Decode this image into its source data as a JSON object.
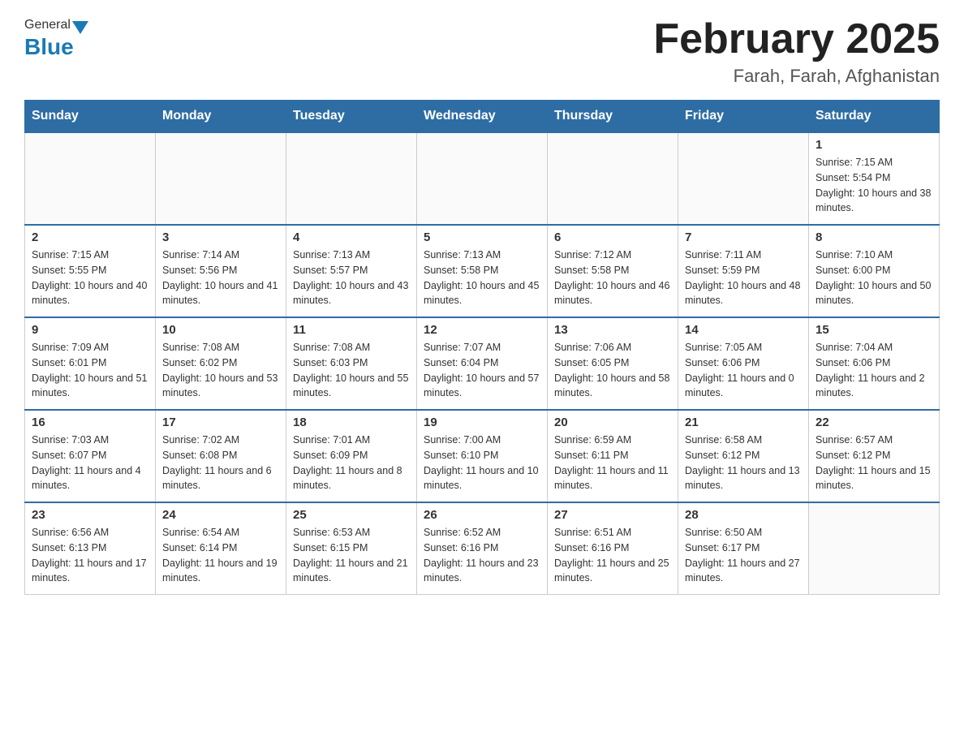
{
  "header": {
    "logo_general": "General",
    "logo_blue": "Blue",
    "title": "February 2025",
    "subtitle": "Farah, Farah, Afghanistan"
  },
  "days_of_week": [
    "Sunday",
    "Monday",
    "Tuesday",
    "Wednesday",
    "Thursday",
    "Friday",
    "Saturday"
  ],
  "weeks": [
    [
      {
        "day": "",
        "sunrise": "",
        "sunset": "",
        "daylight": ""
      },
      {
        "day": "",
        "sunrise": "",
        "sunset": "",
        "daylight": ""
      },
      {
        "day": "",
        "sunrise": "",
        "sunset": "",
        "daylight": ""
      },
      {
        "day": "",
        "sunrise": "",
        "sunset": "",
        "daylight": ""
      },
      {
        "day": "",
        "sunrise": "",
        "sunset": "",
        "daylight": ""
      },
      {
        "day": "",
        "sunrise": "",
        "sunset": "",
        "daylight": ""
      },
      {
        "day": "1",
        "sunrise": "Sunrise: 7:15 AM",
        "sunset": "Sunset: 5:54 PM",
        "daylight": "Daylight: 10 hours and 38 minutes."
      }
    ],
    [
      {
        "day": "2",
        "sunrise": "Sunrise: 7:15 AM",
        "sunset": "Sunset: 5:55 PM",
        "daylight": "Daylight: 10 hours and 40 minutes."
      },
      {
        "day": "3",
        "sunrise": "Sunrise: 7:14 AM",
        "sunset": "Sunset: 5:56 PM",
        "daylight": "Daylight: 10 hours and 41 minutes."
      },
      {
        "day": "4",
        "sunrise": "Sunrise: 7:13 AM",
        "sunset": "Sunset: 5:57 PM",
        "daylight": "Daylight: 10 hours and 43 minutes."
      },
      {
        "day": "5",
        "sunrise": "Sunrise: 7:13 AM",
        "sunset": "Sunset: 5:58 PM",
        "daylight": "Daylight: 10 hours and 45 minutes."
      },
      {
        "day": "6",
        "sunrise": "Sunrise: 7:12 AM",
        "sunset": "Sunset: 5:58 PM",
        "daylight": "Daylight: 10 hours and 46 minutes."
      },
      {
        "day": "7",
        "sunrise": "Sunrise: 7:11 AM",
        "sunset": "Sunset: 5:59 PM",
        "daylight": "Daylight: 10 hours and 48 minutes."
      },
      {
        "day": "8",
        "sunrise": "Sunrise: 7:10 AM",
        "sunset": "Sunset: 6:00 PM",
        "daylight": "Daylight: 10 hours and 50 minutes."
      }
    ],
    [
      {
        "day": "9",
        "sunrise": "Sunrise: 7:09 AM",
        "sunset": "Sunset: 6:01 PM",
        "daylight": "Daylight: 10 hours and 51 minutes."
      },
      {
        "day": "10",
        "sunrise": "Sunrise: 7:08 AM",
        "sunset": "Sunset: 6:02 PM",
        "daylight": "Daylight: 10 hours and 53 minutes."
      },
      {
        "day": "11",
        "sunrise": "Sunrise: 7:08 AM",
        "sunset": "Sunset: 6:03 PM",
        "daylight": "Daylight: 10 hours and 55 minutes."
      },
      {
        "day": "12",
        "sunrise": "Sunrise: 7:07 AM",
        "sunset": "Sunset: 6:04 PM",
        "daylight": "Daylight: 10 hours and 57 minutes."
      },
      {
        "day": "13",
        "sunrise": "Sunrise: 7:06 AM",
        "sunset": "Sunset: 6:05 PM",
        "daylight": "Daylight: 10 hours and 58 minutes."
      },
      {
        "day": "14",
        "sunrise": "Sunrise: 7:05 AM",
        "sunset": "Sunset: 6:06 PM",
        "daylight": "Daylight: 11 hours and 0 minutes."
      },
      {
        "day": "15",
        "sunrise": "Sunrise: 7:04 AM",
        "sunset": "Sunset: 6:06 PM",
        "daylight": "Daylight: 11 hours and 2 minutes."
      }
    ],
    [
      {
        "day": "16",
        "sunrise": "Sunrise: 7:03 AM",
        "sunset": "Sunset: 6:07 PM",
        "daylight": "Daylight: 11 hours and 4 minutes."
      },
      {
        "day": "17",
        "sunrise": "Sunrise: 7:02 AM",
        "sunset": "Sunset: 6:08 PM",
        "daylight": "Daylight: 11 hours and 6 minutes."
      },
      {
        "day": "18",
        "sunrise": "Sunrise: 7:01 AM",
        "sunset": "Sunset: 6:09 PM",
        "daylight": "Daylight: 11 hours and 8 minutes."
      },
      {
        "day": "19",
        "sunrise": "Sunrise: 7:00 AM",
        "sunset": "Sunset: 6:10 PM",
        "daylight": "Daylight: 11 hours and 10 minutes."
      },
      {
        "day": "20",
        "sunrise": "Sunrise: 6:59 AM",
        "sunset": "Sunset: 6:11 PM",
        "daylight": "Daylight: 11 hours and 11 minutes."
      },
      {
        "day": "21",
        "sunrise": "Sunrise: 6:58 AM",
        "sunset": "Sunset: 6:12 PM",
        "daylight": "Daylight: 11 hours and 13 minutes."
      },
      {
        "day": "22",
        "sunrise": "Sunrise: 6:57 AM",
        "sunset": "Sunset: 6:12 PM",
        "daylight": "Daylight: 11 hours and 15 minutes."
      }
    ],
    [
      {
        "day": "23",
        "sunrise": "Sunrise: 6:56 AM",
        "sunset": "Sunset: 6:13 PM",
        "daylight": "Daylight: 11 hours and 17 minutes."
      },
      {
        "day": "24",
        "sunrise": "Sunrise: 6:54 AM",
        "sunset": "Sunset: 6:14 PM",
        "daylight": "Daylight: 11 hours and 19 minutes."
      },
      {
        "day": "25",
        "sunrise": "Sunrise: 6:53 AM",
        "sunset": "Sunset: 6:15 PM",
        "daylight": "Daylight: 11 hours and 21 minutes."
      },
      {
        "day": "26",
        "sunrise": "Sunrise: 6:52 AM",
        "sunset": "Sunset: 6:16 PM",
        "daylight": "Daylight: 11 hours and 23 minutes."
      },
      {
        "day": "27",
        "sunrise": "Sunrise: 6:51 AM",
        "sunset": "Sunset: 6:16 PM",
        "daylight": "Daylight: 11 hours and 25 minutes."
      },
      {
        "day": "28",
        "sunrise": "Sunrise: 6:50 AM",
        "sunset": "Sunset: 6:17 PM",
        "daylight": "Daylight: 11 hours and 27 minutes."
      },
      {
        "day": "",
        "sunrise": "",
        "sunset": "",
        "daylight": ""
      }
    ]
  ]
}
